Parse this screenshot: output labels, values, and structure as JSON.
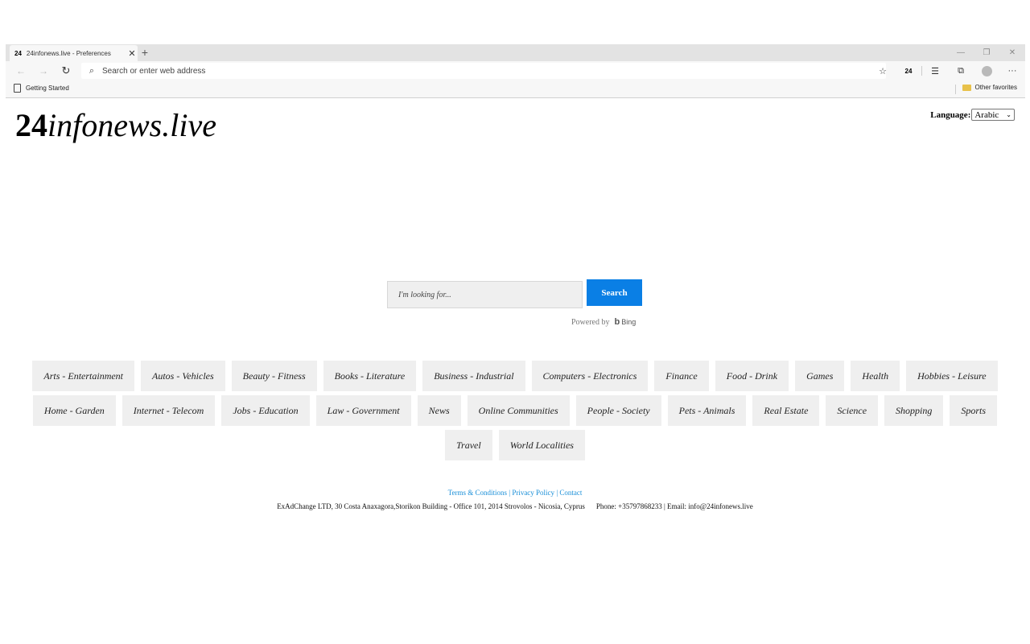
{
  "browser": {
    "tab": {
      "favicon_text": "24",
      "title": "24infonews.live - Preferences",
      "close": "✕"
    },
    "new_tab": "+",
    "window_controls": {
      "minimize": "—",
      "restore": "❐",
      "close": "✕"
    },
    "nav": {
      "back": "←",
      "forward": "→",
      "reload": "↻"
    },
    "address_placeholder": "Search or enter web address",
    "search_glyph": "⌕",
    "toolbar": {
      "favorite": "☆",
      "extension_text": "24",
      "favorites_list": "☰",
      "collections": "⧉",
      "more": "···"
    },
    "favorites_bar": {
      "left_item": "Getting Started",
      "right_item": "Other favorites"
    }
  },
  "site": {
    "logo_number": "24",
    "logo_text": "infonews.live",
    "language_label": "Language:",
    "language_value": "Arabic",
    "language_arrow": "⌄",
    "search_placeholder": "I'm looking for...",
    "search_button": "Search",
    "powered_by": "Powered by",
    "bing_mark": "b",
    "bing_text": "Bing",
    "categories": [
      "Arts - Entertainment",
      "Autos - Vehicles",
      "Beauty - Fitness",
      "Books - Literature",
      "Business - Industrial",
      "Computers - Electronics",
      "Finance",
      "Food - Drink",
      "Games",
      "Health",
      "Hobbies - Leisure",
      "Home - Garden",
      "Internet - Telecom",
      "Jobs - Education",
      "Law - Government",
      "News",
      "Online Communities",
      "People - Society",
      "Pets - Animals",
      "Real Estate",
      "Science",
      "Shopping",
      "Sports",
      "Travel",
      "World Localities"
    ],
    "footer": {
      "terms": "Terms & Conditions",
      "privacy": "Privacy Policy",
      "contact": "Contact",
      "separator": "|",
      "address": "ExAdChange LTD, 30 Costa Anaxagora,Storikon Building - Office 101, 2014 Strovolos - Nicosia, Cyprus",
      "phone_email": "Phone: +35797868233 | Email: info@24infonews.live"
    }
  }
}
